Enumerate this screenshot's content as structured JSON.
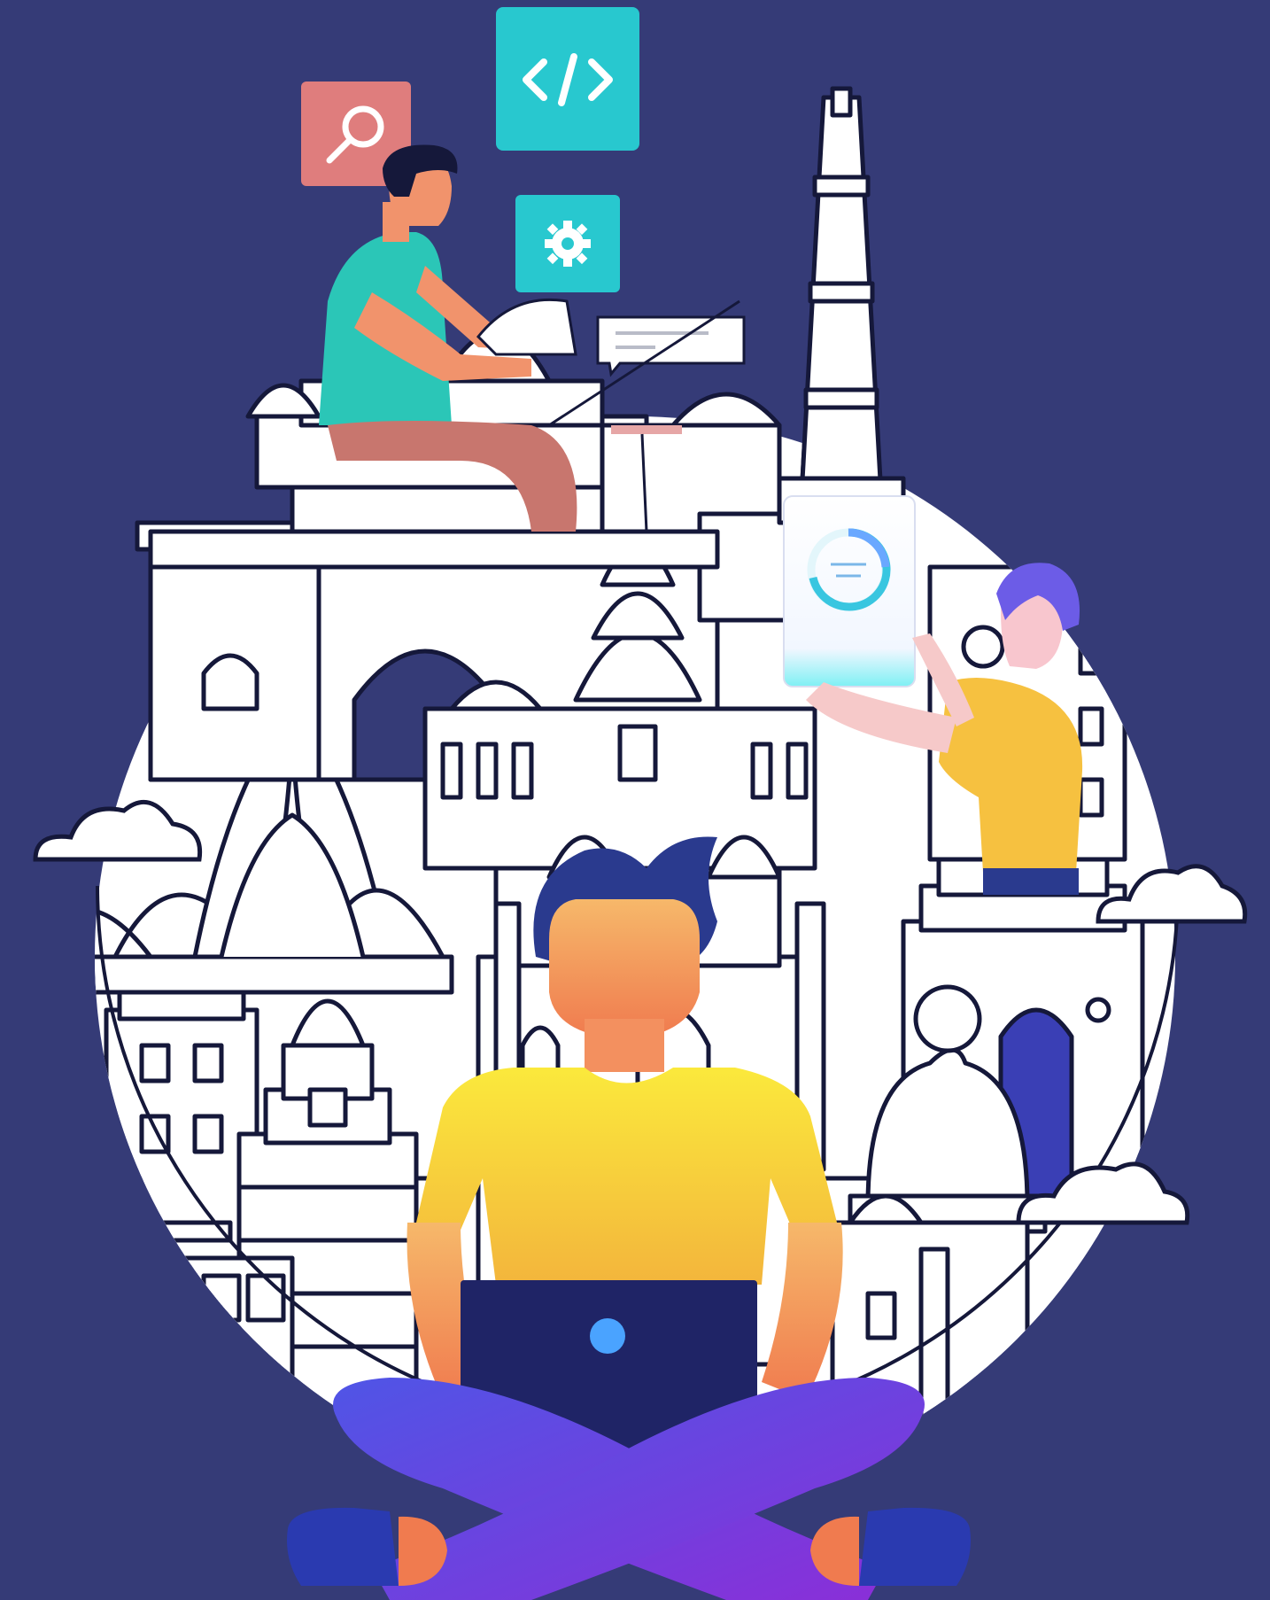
{
  "palette": {
    "background": "#353b77",
    "outline": "#15183a",
    "landmark_fill": "#ffffff",
    "search_tile": "#df7d7d",
    "code_tile": "#28c8cf",
    "settings_tile": "#28c8cf",
    "shirt_teal": "#2bc6b7",
    "skin": "#f1936c",
    "shirt_yellow": "#f6d33b",
    "hair_navy": "#2a3a8e",
    "pants_purple": "#6d3fe0",
    "laptop_navy": "#1f2466",
    "laptop_dot": "#4aa3ff"
  },
  "icons": [
    "search-icon",
    "code-icon",
    "gear-icon",
    "chart-ring-icon",
    "speech-bubble-icon"
  ]
}
